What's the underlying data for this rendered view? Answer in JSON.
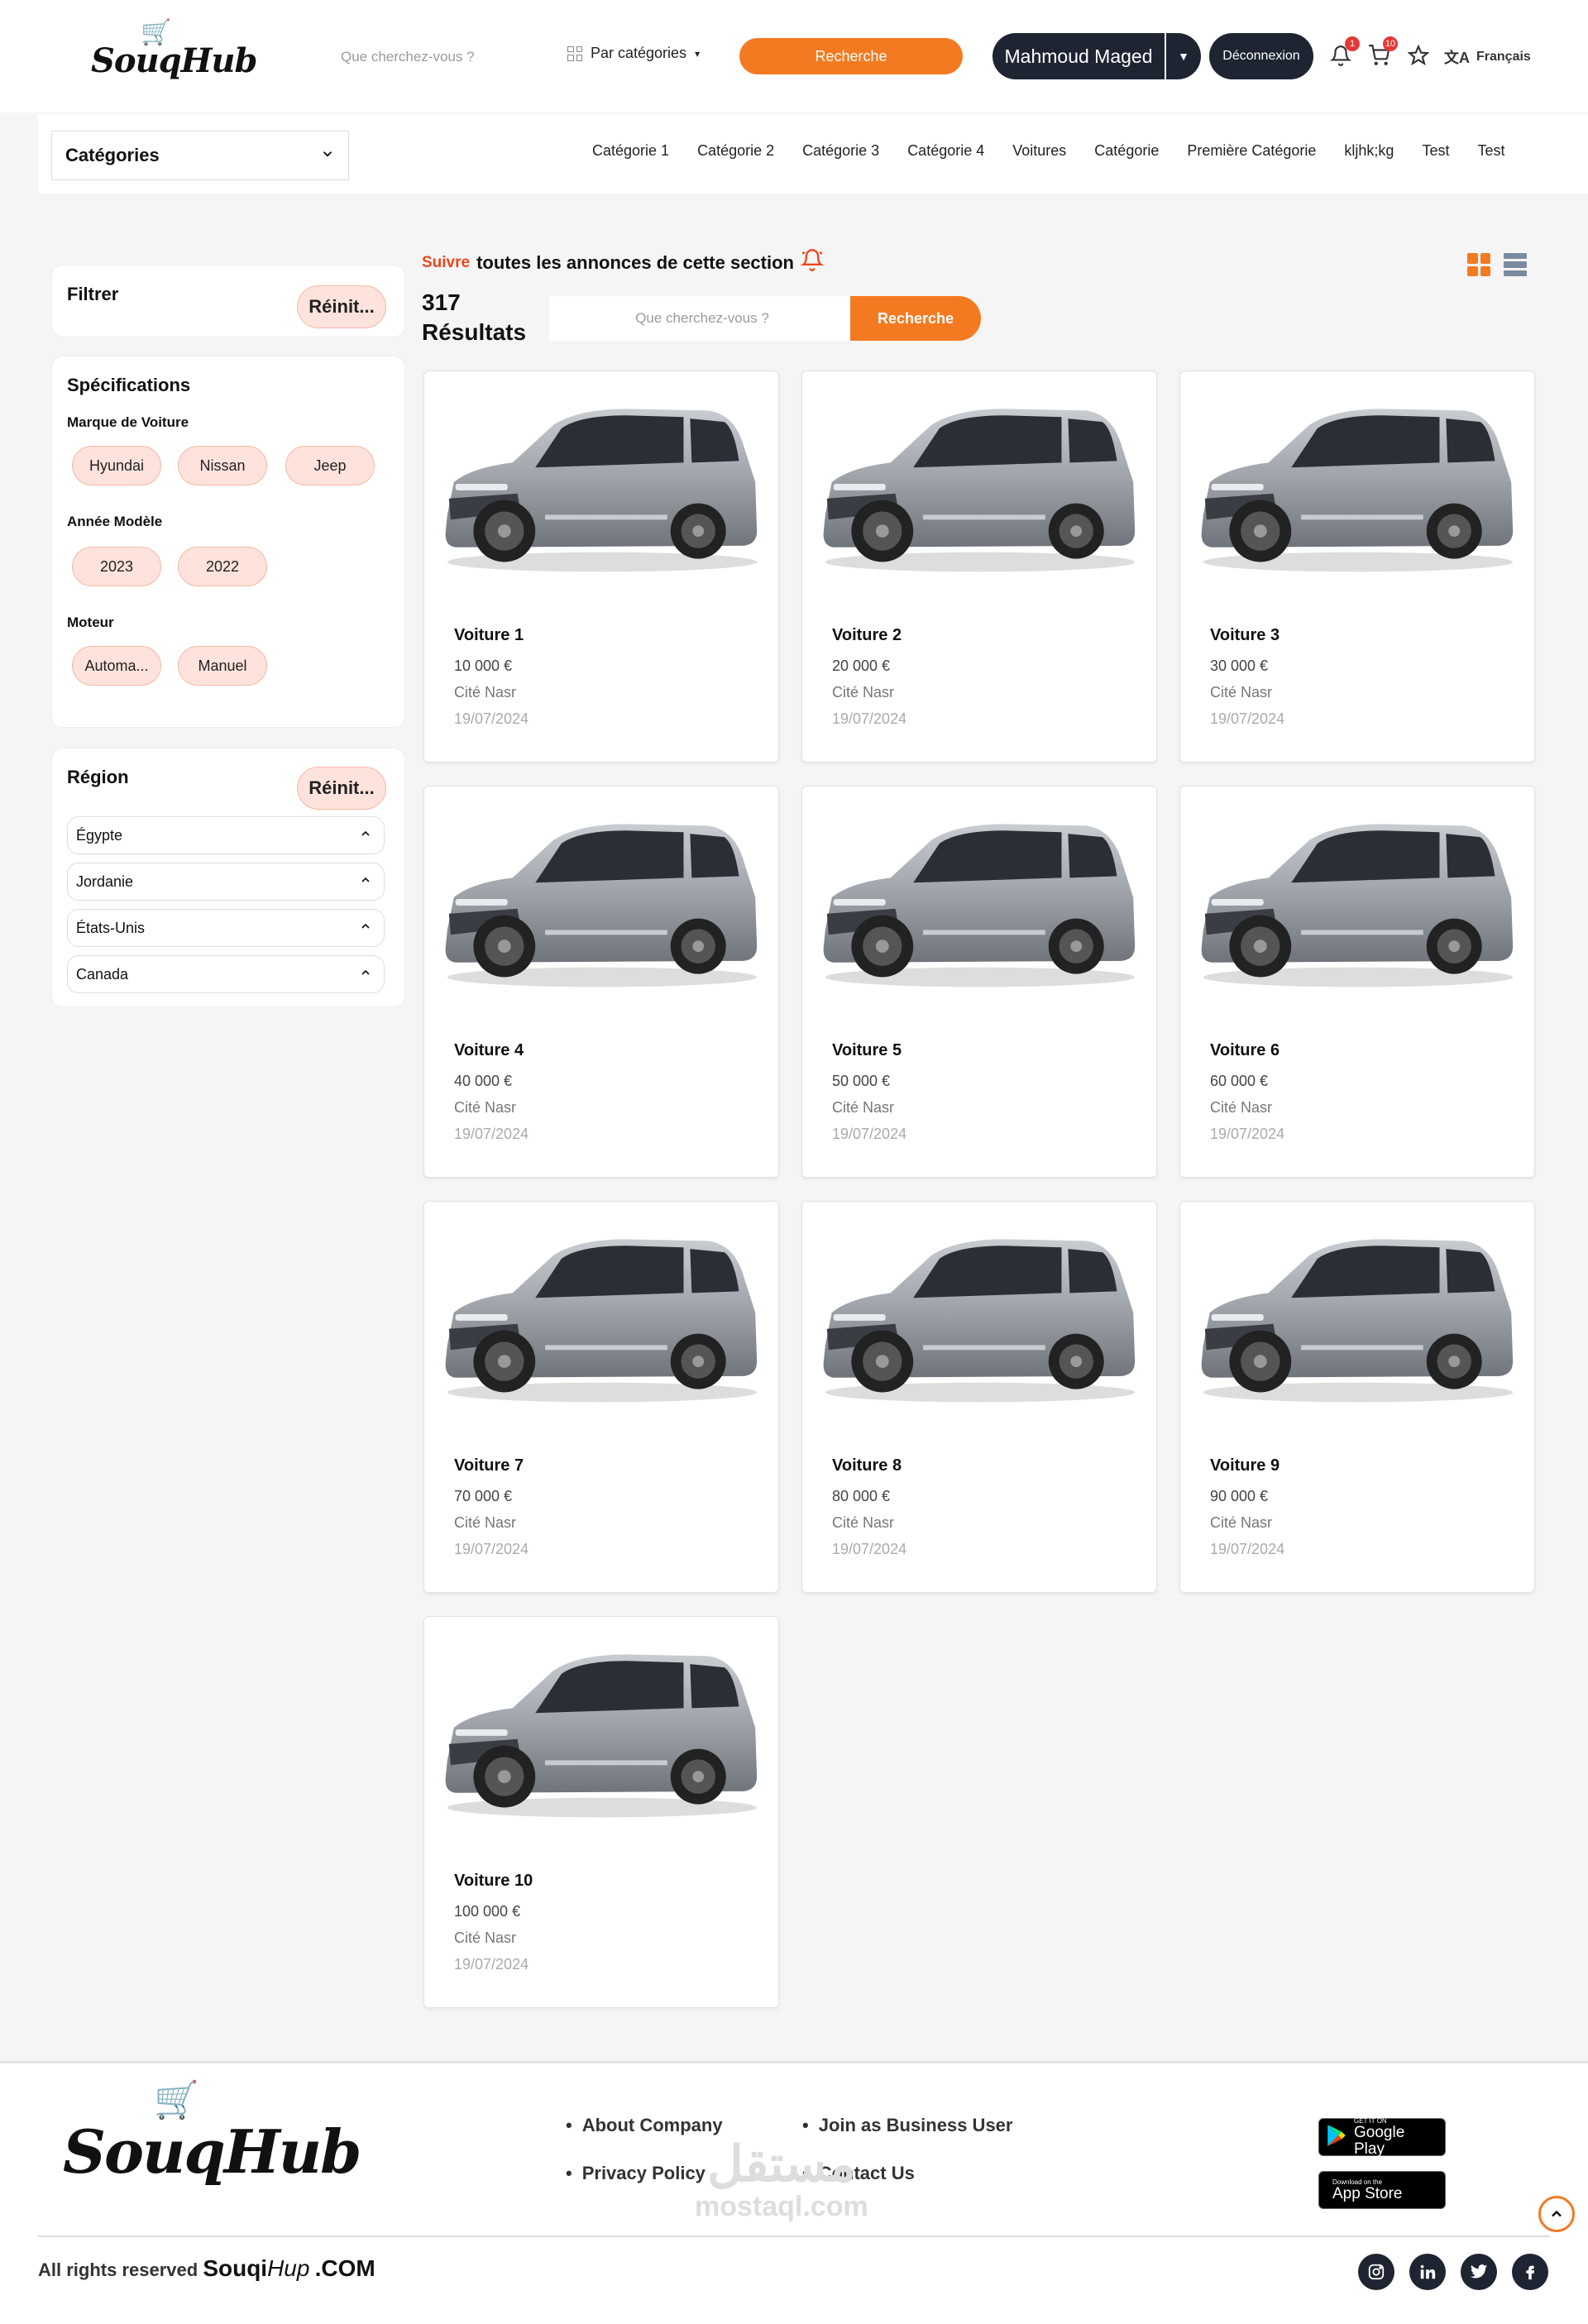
{
  "header": {
    "logo_text": "SouqHub",
    "search_placeholder": "Que cherchez-vous ?",
    "category_select": "Par catégories",
    "search_button": "Recherche",
    "user_name": "Mahmoud Maged",
    "logout": "Déconnexion",
    "notifications_count": "1",
    "cart_count": "10",
    "language": "Français",
    "accent_color": "#f37a21",
    "dark_color": "#1f2433"
  },
  "category_bar": {
    "dropdown_label": "Catégories",
    "links": [
      "Catégorie 1",
      "Catégorie 2",
      "Catégorie 3",
      "Catégorie 4",
      "Voitures",
      "Catégorie",
      "Première Catégorie",
      "kljhk;kg",
      "Test",
      "Test"
    ]
  },
  "sidebar": {
    "filter": {
      "title": "Filtrer",
      "reset": "Réinit..."
    },
    "specs": {
      "title": "Spécifications",
      "brand_label": "Marque de Voiture",
      "brands": [
        "Hyundai",
        "Nissan",
        "Jeep"
      ],
      "year_label": "Année Modèle",
      "years": [
        "2023",
        "2022"
      ],
      "engine_label": "Moteur",
      "engines": [
        "Automa...",
        "Manuel"
      ]
    },
    "region": {
      "title": "Région",
      "reset": "Réinit...",
      "items": [
        "Égypte",
        "Jordanie",
        "États-Unis",
        "Canada"
      ]
    }
  },
  "main": {
    "follow_prefix": "Suivre",
    "follow_text": "toutes les annonces de cette section",
    "results_count": "317",
    "results_label": "Résultats",
    "search_placeholder": "Que cherchez-vous ?",
    "search_button": "Recherche",
    "listings": [
      {
        "title": "Voiture 1",
        "price": "10 000 €",
        "location": "Cité Nasr",
        "date": "19/07/2024"
      },
      {
        "title": "Voiture 2",
        "price": "20 000 €",
        "location": "Cité Nasr",
        "date": "19/07/2024"
      },
      {
        "title": "Voiture 3",
        "price": "30 000 €",
        "location": "Cité Nasr",
        "date": "19/07/2024"
      },
      {
        "title": "Voiture 4",
        "price": "40 000 €",
        "location": "Cité Nasr",
        "date": "19/07/2024"
      },
      {
        "title": "Voiture 5",
        "price": "50 000 €",
        "location": "Cité Nasr",
        "date": "19/07/2024"
      },
      {
        "title": "Voiture 6",
        "price": "60 000 €",
        "location": "Cité Nasr",
        "date": "19/07/2024"
      },
      {
        "title": "Voiture 7",
        "price": "70 000 €",
        "location": "Cité Nasr",
        "date": "19/07/2024"
      },
      {
        "title": "Voiture 8",
        "price": "80 000 €",
        "location": "Cité Nasr",
        "date": "19/07/2024"
      },
      {
        "title": "Voiture 9",
        "price": "90 000 €",
        "location": "Cité Nasr",
        "date": "19/07/2024"
      },
      {
        "title": "Voiture 10",
        "price": "100 000 €",
        "location": "Cité Nasr",
        "date": "19/07/2024"
      }
    ]
  },
  "footer": {
    "logo_text": "SouqHub",
    "links": [
      "About Company",
      "Join as Business User",
      "Privacy Policy",
      "Contact Us"
    ],
    "google_play_small": "GET IT ON",
    "google_play": "Google Play",
    "app_store_small": "Download on the",
    "app_store": "App Store",
    "copyright_prefix": "All rights reserved",
    "copyright_brand_a": "Souqi",
    "copyright_brand_b": "Hup",
    "copyright_suffix": ".COM",
    "watermark_arabic": "مستقل",
    "watermark_latin": "mostaql.com",
    "social_icons": [
      "instagram-icon",
      "linkedin-icon",
      "twitter-icon",
      "facebook-icon"
    ]
  }
}
